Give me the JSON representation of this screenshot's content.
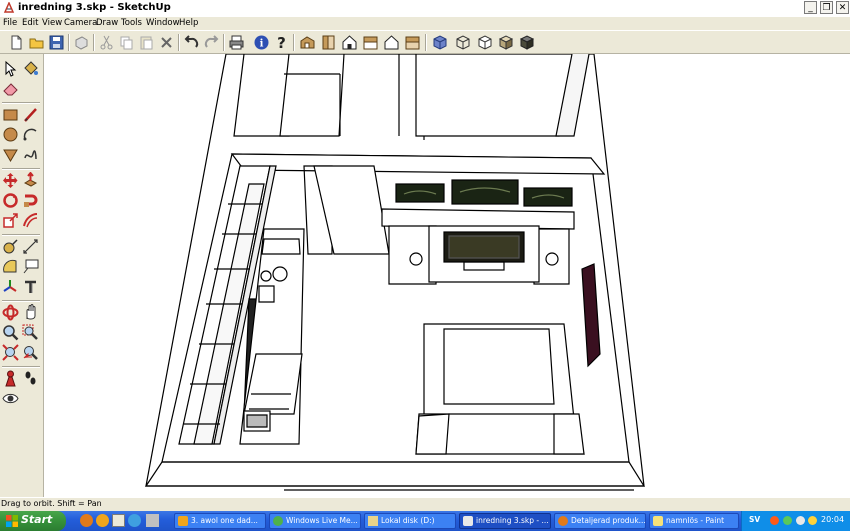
{
  "window": {
    "title": "inredning 3.skp - SketchUp",
    "minimize_glyph": "_",
    "restore_glyph": "❐",
    "close_glyph": "✕"
  },
  "menu": [
    "File",
    "Edit",
    "View",
    "Camera",
    "Draw",
    "Tools",
    "Window",
    "Help"
  ],
  "toolbar_icons": [
    "new-icon",
    "open-icon",
    "save-icon",
    "make-component-icon",
    "cut-icon",
    "copy-icon",
    "paste-icon",
    "erase-icon",
    "undo-icon",
    "redo-icon",
    "print-icon",
    "model-info-icon",
    "help-icon",
    "iso-view-icon",
    "top-view-icon",
    "front-view-icon",
    "right-view-icon",
    "back-view-icon",
    "left-view-icon",
    "xray-icon",
    "wireframe-icon",
    "hidden-line-icon",
    "shaded-icon",
    "textured-icon"
  ],
  "left_tools": [
    "select-icon",
    "paint-bucket-icon",
    "eraser-icon",
    "rectangle-icon",
    "line-icon",
    "circle-icon",
    "arc-icon",
    "polygon-icon",
    "freehand-icon",
    "move-icon",
    "push-pull-icon",
    "rotate-icon",
    "follow-me-icon",
    "scale-icon",
    "offset-icon",
    "tape-measure-icon",
    "dimension-icon",
    "protractor-icon",
    "text-icon",
    "axes-icon",
    "3d-text-icon",
    "orbit-icon",
    "pan-icon",
    "zoom-icon",
    "zoom-window-icon",
    "zoom-extents-icon",
    "previous-view-icon",
    "position-camera-icon",
    "walk-icon",
    "look-around-icon"
  ],
  "status": {
    "text": "Drag to orbit.  Shift = Pan"
  },
  "taskbar": {
    "start_label": "Start",
    "tasks": [
      {
        "label": "3. awol one  dad...",
        "active": false,
        "icon": "winamp-icon"
      },
      {
        "label": "Windows Live Me...",
        "active": false,
        "icon": "messenger-icon"
      },
      {
        "label": "Lokal disk (D:)",
        "active": false,
        "icon": "folder-icon"
      },
      {
        "label": "inredning 3.skp - ...",
        "active": true,
        "icon": "sketchup-icon"
      },
      {
        "label": "Detaljerad produk...",
        "active": false,
        "icon": "firefox-icon"
      },
      {
        "label": "namnlös - Paint",
        "active": false,
        "icon": "paint-icon"
      }
    ],
    "language": "SV",
    "clock": "20:04"
  },
  "colors": {
    "chrome": "#ece9d8",
    "taskbar": "#245edb",
    "start": "#36913a",
    "tray": "#0f8ee8"
  }
}
